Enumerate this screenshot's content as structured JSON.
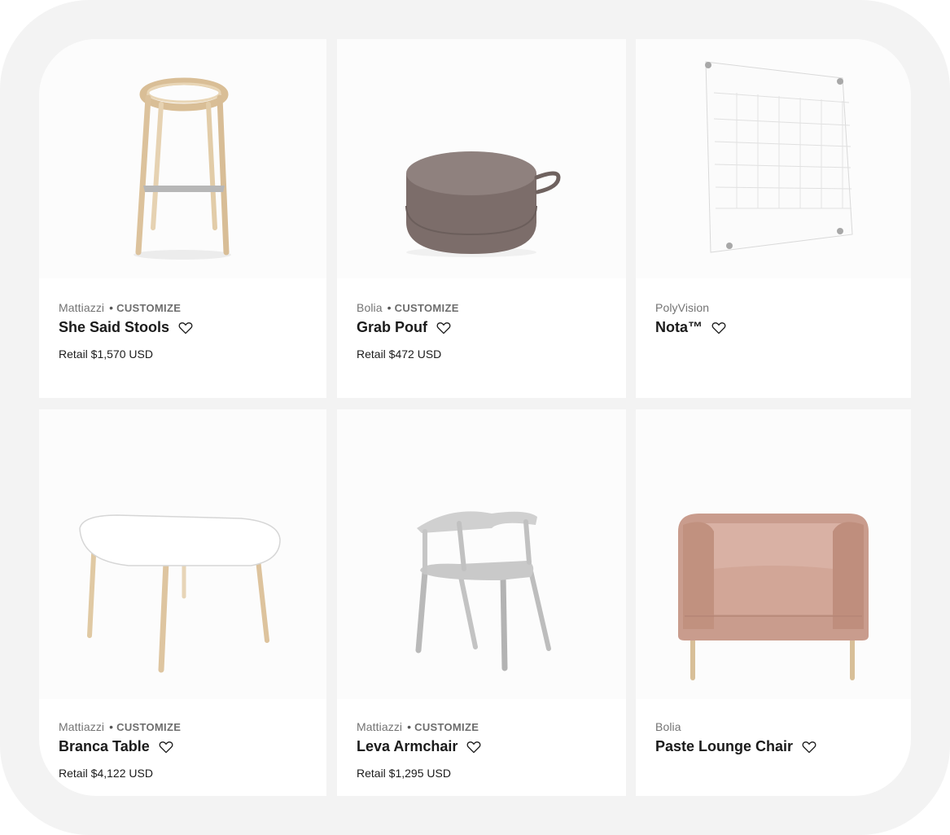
{
  "products": [
    {
      "brand": "Mattiazzi",
      "tag": "CUSTOMIZE",
      "name": "She Said Stools",
      "price": "Retail $1,570 USD",
      "image": "bar-stool"
    },
    {
      "brand": "Bolia",
      "tag": "CUSTOMIZE",
      "name": "Grab Pouf",
      "price": "Retail $472 USD",
      "image": "round-pouf"
    },
    {
      "brand": "PolyVision",
      "tag": "",
      "name": "Nota™",
      "price": "",
      "image": "glass-calendar-board"
    },
    {
      "brand": "Mattiazzi",
      "tag": "CUSTOMIZE",
      "name": "Branca Table",
      "price": "Retail $4,122 USD",
      "image": "white-table"
    },
    {
      "brand": "Mattiazzi",
      "tag": "CUSTOMIZE",
      "name": "Leva Armchair",
      "price": "Retail $1,295 USD",
      "image": "grey-armchair"
    },
    {
      "brand": "Bolia",
      "tag": "",
      "name": "Paste Lounge Chair",
      "price": "",
      "image": "pink-lounge-chair"
    }
  ],
  "icons": {
    "favorite": "heart-outline-icon",
    "more": "more-horizontal-icon"
  },
  "separator": "•"
}
